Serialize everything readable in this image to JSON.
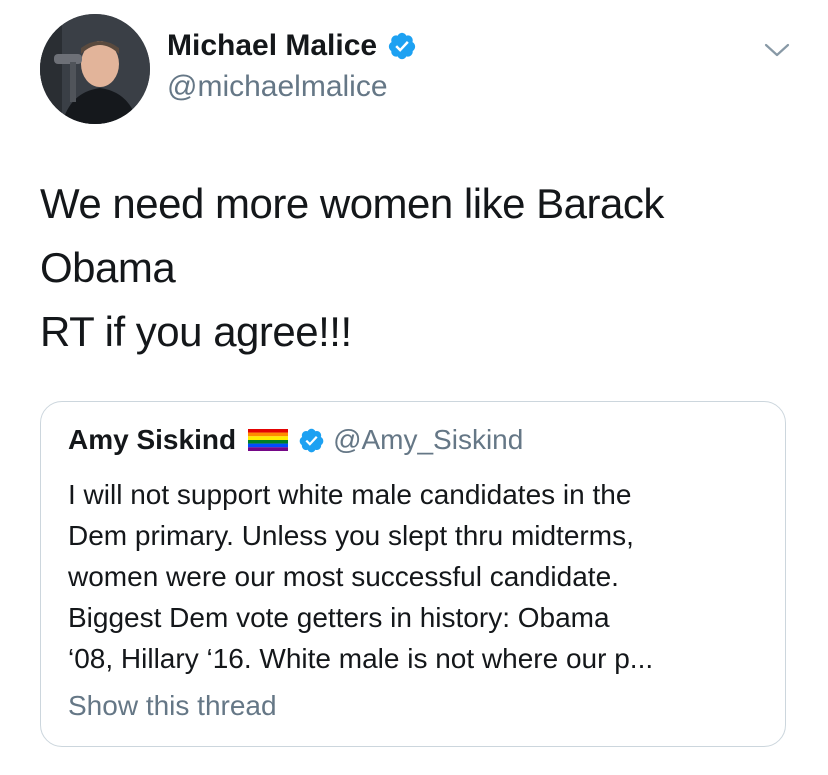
{
  "author": {
    "display_name": "Michael Malice",
    "handle": "@michaelmalice",
    "verified_icon": "verified-badge-icon"
  },
  "tweet": {
    "lines": [
      "We need more women like Barack",
      "Obama",
      "RT if you agree!!!"
    ]
  },
  "quoted_tweet": {
    "display_name": "Amy Siskind",
    "handle": "@Amy_Siskind",
    "flag_icon": "rainbow-flag-icon",
    "lines": [
      "I will not support white male candidates in the",
      "Dem primary. Unless you slept thru midterms,",
      "women were our most successful candidate.",
      "Biggest Dem vote getters in history: Obama",
      "‘08, Hillary ‘16.  White male is not where our p..."
    ],
    "show_thread": "Show this thread"
  },
  "colors": {
    "text": "#14171a",
    "secondary": "#657786",
    "verified_blue": "#1da1f2",
    "border": "#ccd6dd"
  }
}
